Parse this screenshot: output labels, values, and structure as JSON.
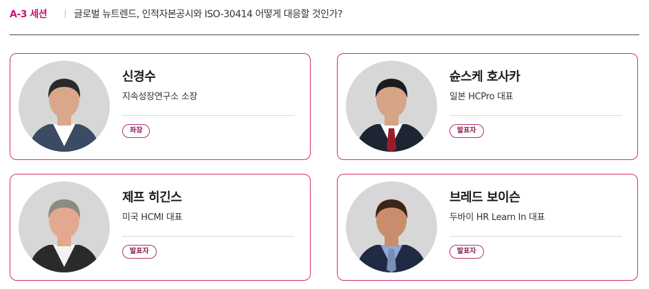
{
  "header": {
    "session_code": "A-3 세션",
    "session_title": "글로벌 뉴트렌드, 인적자본공시와 ISO-30414 어떻게 대응할 것인가?"
  },
  "speakers": [
    {
      "name": "신경수",
      "affiliation": "지속성장연구소 소장",
      "role": "좌장",
      "colors": {
        "shirt": "#ffffff",
        "suit": "#3a4b63",
        "tie": null,
        "hair": "#2a2a2a",
        "skin": "#d9a88a"
      }
    },
    {
      "name": "슌스케 호사카",
      "affiliation": "일본 HCPro 대표",
      "role": "발표자",
      "colors": {
        "shirt": "#ffffff",
        "suit": "#1e2433",
        "tie": "#9b1c2c",
        "hair": "#1c1c1c",
        "skin": "#d6a585"
      }
    },
    {
      "name": "제프 히긴스",
      "affiliation": "미국 HCMI 대표",
      "role": "발표자",
      "colors": {
        "shirt": "#f2f2f2",
        "suit": "#2a2a2a",
        "tie": null,
        "hair": "#8e8a83",
        "skin": "#e2a98f"
      }
    },
    {
      "name": "브레드 보이슨",
      "affiliation": "두바이 HR Learn In 대표",
      "role": "발표자",
      "colors": {
        "shirt": "#8fa8d4",
        "suit": "#1f2a44",
        "tie": "#7a8fb8",
        "hair": "#3b2618",
        "skin": "#c98d6c"
      }
    }
  ]
}
